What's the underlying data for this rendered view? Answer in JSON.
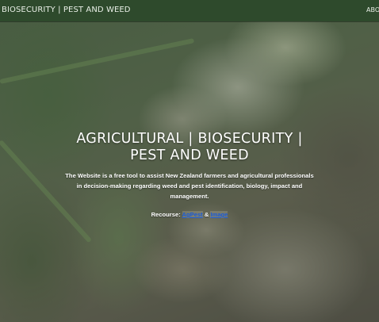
{
  "navbar": {
    "brand": "BIOSECURITY | PEST AND WEED",
    "link_about": "ABOUT"
  },
  "hero": {
    "title": "AGRICULTURAL | BIOSECURITY | PEST AND WEED",
    "description": "The Website is a free tool to assist New Zealand farmers and agricultural professionals in decision-making regarding weed and pest identification, biology, impact and management.",
    "resource_label": "Recourse:",
    "resource_link_1": "AgPest",
    "resource_separator": "&",
    "resource_link_2": "Image"
  },
  "colors": {
    "navbar_bg": "#2e4a2c",
    "link": "#1a5bd6"
  }
}
